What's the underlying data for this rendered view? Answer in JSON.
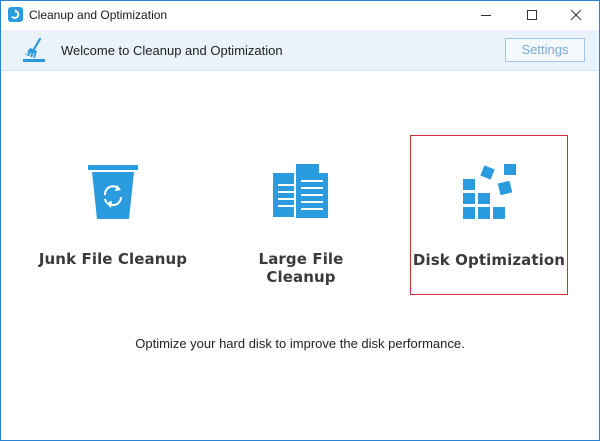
{
  "window": {
    "title": "Cleanup and Optimization"
  },
  "header": {
    "welcome": "Welcome to Cleanup and Optimization",
    "settings_label": "Settings"
  },
  "tiles": [
    {
      "label": "Junk File Cleanup",
      "icon": "recycle-bin-icon",
      "selected": false
    },
    {
      "label": "Large File Cleanup",
      "icon": "documents-icon",
      "selected": false
    },
    {
      "label": "Disk Optimization",
      "icon": "disk-blocks-icon",
      "selected": true
    }
  ],
  "description": "Optimize your hard disk to improve the disk performance.",
  "colors": {
    "accent": "#2b9be0",
    "selection": "#d32f3a",
    "header_bg": "#eaf3fc"
  }
}
